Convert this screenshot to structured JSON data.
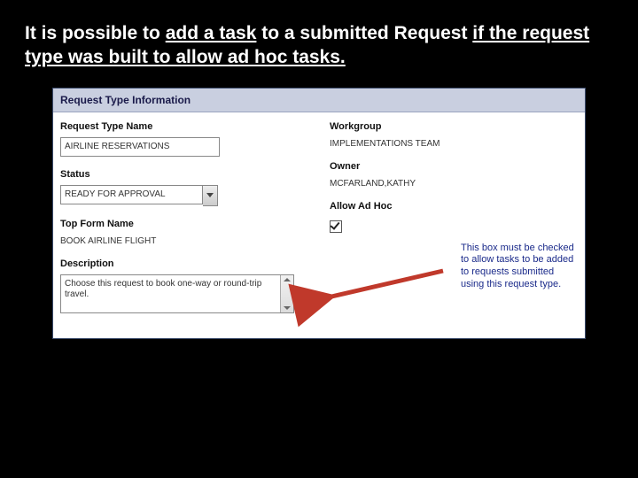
{
  "headline": {
    "pre": "It is possible to ",
    "add": "add a task",
    "mid": " to a submitted Request ",
    "tail": "if the request type was built to allow ad hoc tasks."
  },
  "panel_title": "Request Type Information",
  "left": {
    "name_label": "Request Type Name",
    "name_value": "AIRLINE RESERVATIONS",
    "status_label": "Status",
    "status_value": "READY FOR APPROVAL",
    "topform_label": "Top Form Name",
    "topform_value": "BOOK AIRLINE FLIGHT",
    "desc_label": "Description",
    "desc_value": "Choose this request to book one-way or round-trip travel."
  },
  "right": {
    "workgroup_label": "Workgroup",
    "workgroup_value": "IMPLEMENTATIONS TEAM",
    "owner_label": "Owner",
    "owner_value": "MCFARLAND,KATHY",
    "adhoc_label": "Allow Ad Hoc"
  },
  "callout": "This box must be checked to allow tasks to be added to requests submitted using this request type."
}
